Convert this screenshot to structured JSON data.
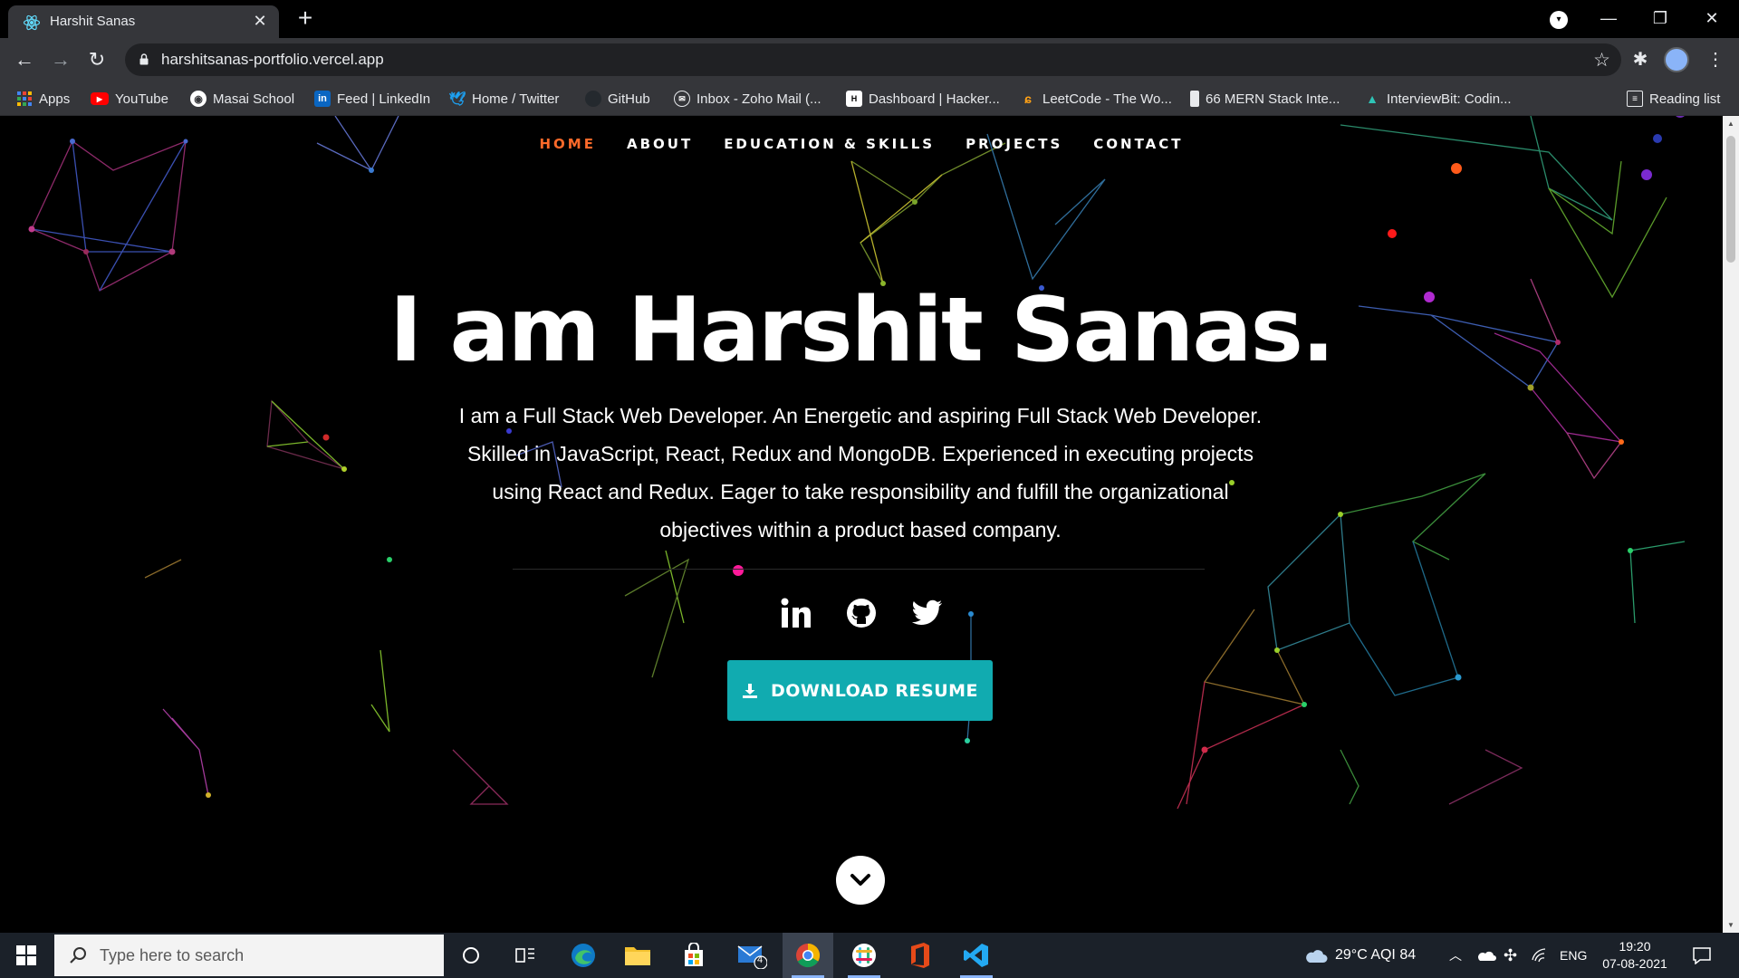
{
  "browser": {
    "tab_title": "Harshit Sanas",
    "url": "harshitsanas-portfolio.vercel.app",
    "bookmarks": [
      {
        "label": "Apps",
        "icon": "apps-grid-icon",
        "color": "#4285f4"
      },
      {
        "label": "YouTube",
        "icon": "youtube-icon",
        "color": "#ff0000"
      },
      {
        "label": "Masai School",
        "icon": "globe-icon",
        "color": "#ffffff"
      },
      {
        "label": "Feed | LinkedIn",
        "icon": "linkedin-icon",
        "color": "#0a66c2"
      },
      {
        "label": "Home / Twitter",
        "icon": "twitter-icon",
        "color": "#1da1f2"
      },
      {
        "label": "GitHub",
        "icon": "github-icon",
        "color": "#24292e"
      },
      {
        "label": "Inbox - Zoho Mail (...",
        "icon": "zoho-mail-icon",
        "color": "#e8eaed"
      },
      {
        "label": "Dashboard | Hacker...",
        "icon": "hackerrank-icon",
        "color": "#000000"
      },
      {
        "label": "LeetCode - The Wo...",
        "icon": "leetcode-icon",
        "color": "#ffa116"
      },
      {
        "label": "66 MERN Stack Inte...",
        "icon": "bookmark-page-icon",
        "color": "#e8eaed"
      },
      {
        "label": "InterviewBit: Codin...",
        "icon": "interviewbit-icon",
        "color": "#2ec4b6"
      }
    ],
    "reading_list": "Reading list"
  },
  "site": {
    "nav": [
      {
        "label": "HOME",
        "active": true
      },
      {
        "label": "ABOUT",
        "active": false
      },
      {
        "label": "EDUCATION & SKILLS",
        "active": false
      },
      {
        "label": "PROJECTS",
        "active": false
      },
      {
        "label": "CONTACT",
        "active": false
      }
    ],
    "heading": "I am Harshit Sanas.",
    "description": "I am a Full Stack Web Developer. An Energetic and aspiring Full Stack Web Developer. Skilled in JavaScript, React, Redux and MongoDB. Experienced in executing projects using React and Redux. Eager to take responsibility and fulfill the organizational objectives within a product based company.",
    "socials": [
      "linkedin-icon",
      "github-icon",
      "twitter-icon"
    ],
    "resume_button": "DOWNLOAD RESUME",
    "accent_color": "#11abb0",
    "active_nav_color": "#ff6a2a"
  },
  "taskbar": {
    "search_placeholder": "Type here to search",
    "mail_badge": "4",
    "weather": "29°C  AQI 84",
    "language": "ENG",
    "time": "19:20",
    "date": "07-08-2021"
  }
}
